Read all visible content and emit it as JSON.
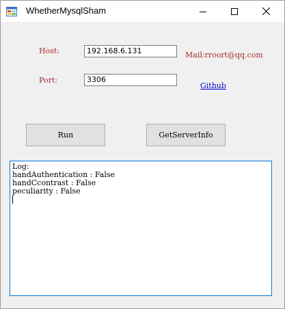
{
  "window": {
    "title": "WhetherMysqlSham"
  },
  "form": {
    "host_label": "Host:",
    "host_value": "192.168.6.131",
    "port_label": "Port:",
    "port_value": "3306",
    "mail_text": "Mail:rroort@qq.com",
    "github_link": "Github"
  },
  "buttons": {
    "run_label": "Run",
    "getserverinfo_label": "GetServerInfo"
  },
  "log": {
    "lines": [
      "Log:",
      "handAuthentication : False",
      "handCcontrast : False",
      "peculiarity : False"
    ]
  },
  "colors": {
    "label_color": "#a52a2a",
    "link_color": "#0000cc",
    "focus_border": "#0078d7"
  }
}
